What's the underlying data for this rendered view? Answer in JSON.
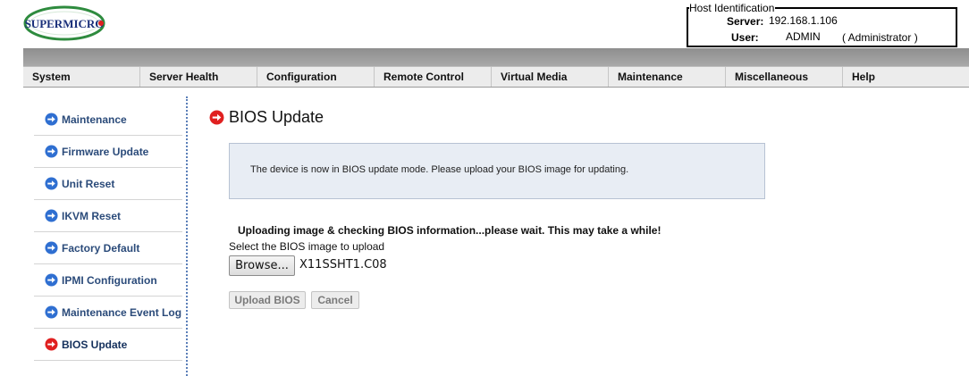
{
  "header": {
    "logo_text": "SUPERMICRO",
    "host_identification": {
      "legend": "Host Identification",
      "server_label": "Server:",
      "server_value": "192.168.1.106",
      "user_label": "User:",
      "user_value": "ADMIN",
      "role": "( Administrator )"
    }
  },
  "menu": [
    "System",
    "Server Health",
    "Configuration",
    "Remote Control",
    "Virtual Media",
    "Maintenance",
    "Miscellaneous",
    "Help"
  ],
  "sidebar": {
    "items": [
      {
        "label": "Maintenance",
        "active": false
      },
      {
        "label": "Firmware Update",
        "active": false
      },
      {
        "label": "Unit Reset",
        "active": false
      },
      {
        "label": "IKVM Reset",
        "active": false
      },
      {
        "label": "Factory Default",
        "active": false
      },
      {
        "label": "IPMI Configuration",
        "active": false
      },
      {
        "label": "Maintenance Event Log",
        "active": false
      },
      {
        "label": "BIOS Update",
        "active": true
      }
    ]
  },
  "main": {
    "title": "BIOS Update",
    "info_message": "The device is now in BIOS update mode. Please upload your BIOS image for updating.",
    "wait_message": "Uploading image & checking BIOS information...please wait. This may take a while!",
    "select_label": "Select the BIOS image to upload",
    "browse_label": "Browse...",
    "file_name": "X11SSHT1.C08",
    "upload_label": "Upload BIOS",
    "cancel_label": "Cancel"
  },
  "colors": {
    "nav_icon": "#2f6fd1",
    "active_icon": "#e02020",
    "logo_green": "#2e8b3e",
    "logo_blue": "#1a2f7a"
  },
  "icons": {
    "nav_arrow": "arrow-right-circle-icon",
    "logo": "supermicro-logo"
  }
}
